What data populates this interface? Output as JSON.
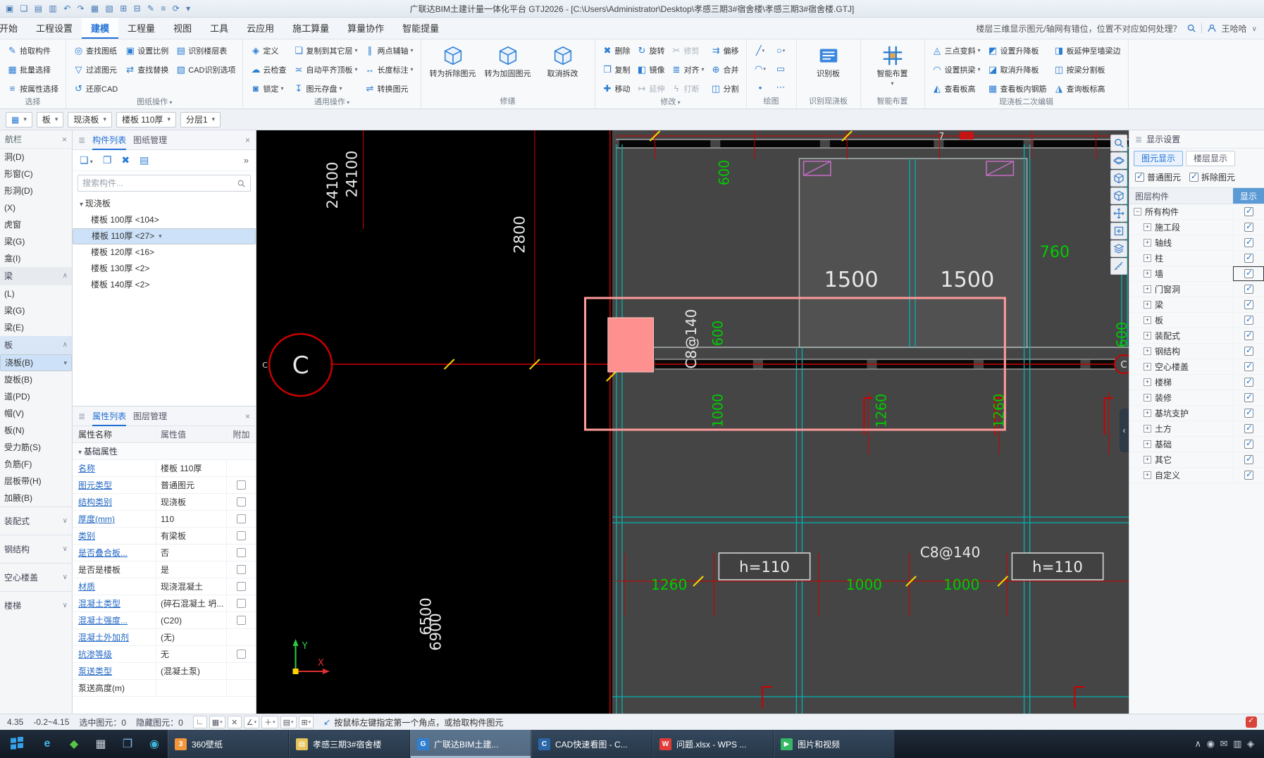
{
  "app": {
    "title": "广联达BIM土建计量一体化平台 GTJ2026 - [C:\\Users\\Administrator\\Desktop\\孝感三期3#宿舍楼\\孝感三期3#宿舍楼.GTJ]",
    "quick_icons": "▣ ❏ ▤ ▥ ↶ ↷ ▦ ▧ ⊞ ⊟ ✎ ≡ ⟳ ▾"
  },
  "tabs": {
    "items": [
      {
        "label": "开始"
      },
      {
        "label": "工程设置"
      },
      {
        "label": "建模",
        "active": true
      },
      {
        "label": "工程量"
      },
      {
        "label": "视图"
      },
      {
        "label": "工具"
      },
      {
        "label": "云应用"
      },
      {
        "label": "施工算量"
      },
      {
        "label": "算量协作"
      },
      {
        "label": "智能提量"
      }
    ],
    "help_text": "楼层三维显示图元/轴网有错位，位置不对应如何处理？",
    "user": "王哈哈"
  },
  "ribbon": {
    "select": {
      "label": "选择",
      "buttons": [
        {
          "t": "拾取构件",
          "i": "✎"
        },
        {
          "t": "批量选择",
          "i": "▦"
        },
        {
          "t": "按属性选择",
          "i": "≡"
        }
      ]
    },
    "sheet_ops": {
      "label": "图纸操作",
      "buttons": [
        {
          "t": "查找图纸",
          "i": "◎"
        },
        {
          "t": "设置比例",
          "i": "▣"
        },
        {
          "t": "识别楼层表",
          "i": "▤"
        },
        {
          "t": "过滤图元",
          "i": "▽"
        },
        {
          "t": "查找替换",
          "i": "⇄"
        },
        {
          "t": "CAD识别选项",
          "i": "▧"
        },
        {
          "t": "还原CAD",
          "i": "↺"
        }
      ]
    },
    "common_ops": {
      "label": "通用操作",
      "buttons": [
        {
          "t": "定义",
          "i": "◈"
        },
        {
          "t": "复制到其它层",
          "i": "❏",
          "dd": true
        },
        {
          "t": "两点辅轴",
          "i": "∥",
          "dd": true
        },
        {
          "t": "云检查",
          "i": "☁"
        },
        {
          "t": "自动平齐顶板",
          "i": "≍",
          "dd": true
        },
        {
          "t": "长度标注",
          "i": "↔",
          "dd": true
        },
        {
          "t": "锁定",
          "i": "◙",
          "dd": true
        },
        {
          "t": "图元存盘",
          "i": "↧",
          "dd": true
        },
        {
          "t": "转换图元",
          "i": "⇌"
        }
      ]
    },
    "renovation": {
      "label": "修缮",
      "buttons": [
        {
          "t": "转为拆除图元"
        },
        {
          "t": "转为加固图元"
        },
        {
          "t": "取消拆改"
        }
      ]
    },
    "modify": {
      "label": "修改",
      "buttons": [
        {
          "t": "删除",
          "i": "✖"
        },
        {
          "t": "旋转",
          "i": "↻"
        },
        {
          "t": "修剪",
          "i": "✂",
          "dis": true
        },
        {
          "t": "偏移",
          "i": "⇉"
        },
        {
          "t": "复制",
          "i": "❐"
        },
        {
          "t": "镜像",
          "i": "◧"
        },
        {
          "t": "对齐",
          "i": "≣",
          "dd": true
        },
        {
          "t": "合并",
          "i": "⊕"
        },
        {
          "t": "移动",
          "i": "✚"
        },
        {
          "t": "延伸",
          "i": "↦",
          "dis": true
        },
        {
          "t": "打断",
          "i": "ϟ",
          "dis": true
        },
        {
          "t": "分割",
          "i": "◫"
        }
      ]
    },
    "draw": {
      "label": "绘图",
      "tools": [
        {
          "i": "╱",
          "dd": true
        },
        {
          "i": "○",
          "dd": true
        },
        {
          "i": "◠",
          "dd": true
        },
        {
          "i": "▭"
        },
        {
          "i": "•"
        },
        {
          "i": "⋯"
        }
      ]
    },
    "identify": {
      "label": "识别现浇板",
      "button": "识别板"
    },
    "smart": {
      "label": "智能布置",
      "button": "智能布置"
    },
    "slab_edit": {
      "label": "现浇板二次编辑",
      "buttons": [
        {
          "t": "三点变斜",
          "i": "◬",
          "dd": true
        },
        {
          "t": "设置升降板",
          "i": "◩"
        },
        {
          "t": "板延伸至墙梁边",
          "i": "◨"
        },
        {
          "t": "设置拱梁",
          "i": "◠",
          "dd": true
        },
        {
          "t": "取消升降板",
          "i": "◪"
        },
        {
          "t": "按梁分割板",
          "i": "◫"
        },
        {
          "t": "查看板高",
          "i": "◭"
        },
        {
          "t": "查看板内钢筋",
          "i": "▦"
        },
        {
          "t": "查询板标高",
          "i": "◮"
        }
      ]
    }
  },
  "selector": {
    "type_icon": "▦",
    "dropdowns": [
      {
        "label": "板"
      },
      {
        "label": "现浇板"
      },
      {
        "label": "楼板 110厚"
      },
      {
        "label": "分层1"
      }
    ]
  },
  "nav": {
    "title": "航栏",
    "close": "×",
    "items": [
      {
        "label": "洞(D)"
      },
      {
        "label": "形窗(C)"
      },
      {
        "label": "形洞(D)"
      },
      {
        "label": "(X)"
      },
      {
        "label": "虎窗"
      },
      {
        "label": "梁(G)"
      },
      {
        "label": "龛(I)"
      },
      {
        "label": "梁",
        "sec": true
      },
      {
        "label": "(L)"
      },
      {
        "label": "梁(G)"
      },
      {
        "label": "梁(E)"
      },
      {
        "label": "板",
        "sec": true,
        "hl": true
      },
      {
        "label": "浇板(B)",
        "sel": true
      },
      {
        "label": "旋板(B)"
      },
      {
        "label": "道(PD)"
      },
      {
        "label": "帽(V)"
      },
      {
        "label": "板(N)"
      },
      {
        "label": "受力筋(S)"
      },
      {
        "label": "负筋(F)"
      },
      {
        "label": "层板带(H)"
      },
      {
        "label": "加腋(B)"
      },
      {
        "label": "装配式",
        "grp": true
      },
      {
        "label": "钢结构",
        "grp": true
      },
      {
        "label": "空心楼盖",
        "grp": true
      },
      {
        "label": "楼梯",
        "grp": true
      }
    ]
  },
  "components": {
    "tabs": [
      {
        "label": "构件列表",
        "active": true
      },
      {
        "label": "图纸管理"
      }
    ],
    "toolbar": {
      "new": "❏",
      "copy": "❐",
      "del": "✖",
      "store": "▤",
      "more": "»"
    },
    "search_placeholder": "搜索构件...",
    "root": "现浇板",
    "items": [
      {
        "label": "楼板 100厚 <104>"
      },
      {
        "label": "楼板 110厚 <27>",
        "sel": true
      },
      {
        "label": "楼板 120厚 <16>"
      },
      {
        "label": "楼板 130厚 <2>"
      },
      {
        "label": "楼板 140厚 <2>"
      }
    ]
  },
  "properties": {
    "tabs": [
      {
        "label": "属性列表",
        "active": true
      },
      {
        "label": "图层管理"
      }
    ],
    "columns": [
      "属性名称",
      "属性值",
      "附加"
    ],
    "group": "基础属性",
    "rows": [
      {
        "name": "名称",
        "value": "楼板 110厚",
        "link": true
      },
      {
        "name": "图元类型",
        "value": "普通图元",
        "link": true,
        "cb": true
      },
      {
        "name": "结构类别",
        "value": "现浇板",
        "link": true,
        "cb": true
      },
      {
        "name": "厚度(mm)",
        "value": "110",
        "link": true,
        "cb": true
      },
      {
        "name": "类别",
        "value": "有梁板",
        "link": true,
        "cb": true
      },
      {
        "name": "是否叠合板...",
        "value": "否",
        "link": true,
        "cb": true
      },
      {
        "name": "是否是楼板",
        "value": "是",
        "cb": true
      },
      {
        "name": "材质",
        "value": "现浇混凝土",
        "link": true,
        "cb": true
      },
      {
        "name": "混凝土类型",
        "value": "(碎石混凝土 坍...",
        "link": true,
        "cb": true
      },
      {
        "name": "混凝土强度...",
        "value": "(C20)",
        "link": true,
        "cb": true
      },
      {
        "name": "混凝土外加剂",
        "value": "(无)",
        "link": true
      },
      {
        "name": "抗渗等级",
        "value": "无",
        "link": true,
        "cb": true
      },
      {
        "name": "泵送类型",
        "value": "(混凝土泵)",
        "link": true
      },
      {
        "name": "泵送高度(m)",
        "value": ""
      }
    ]
  },
  "display": {
    "title": "显示设置",
    "tabs": [
      {
        "label": "图元显示",
        "active": true
      },
      {
        "label": "楼层显示"
      }
    ],
    "filters": [
      {
        "label": "普通图元",
        "checked": true
      },
      {
        "label": "拆除图元",
        "checked": true
      }
    ],
    "columns": [
      "图层构件",
      "显示"
    ],
    "rows": [
      {
        "label": "所有构件",
        "e": "−",
        "cb": true
      },
      {
        "label": "施工段",
        "e": "+",
        "ind": true,
        "cb": true
      },
      {
        "label": "轴线",
        "e": "+",
        "ind": true,
        "cb": true
      },
      {
        "label": "柱",
        "e": "+",
        "ind": true,
        "cb": true
      },
      {
        "label": "墙",
        "e": "+",
        "ind": true,
        "cb": true,
        "focus": true
      },
      {
        "label": "门窗洞",
        "e": "+",
        "ind": true,
        "cb": true
      },
      {
        "label": "梁",
        "e": "+",
        "ind": true,
        "cb": true
      },
      {
        "label": "板",
        "e": "+",
        "ind": true,
        "cb": true
      },
      {
        "label": "装配式",
        "e": "+",
        "ind": true,
        "cb": true
      },
      {
        "label": "钢结构",
        "e": "+",
        "ind": true,
        "cb": true
      },
      {
        "label": "空心楼盖",
        "e": "+",
        "ind": true,
        "cb": true
      },
      {
        "label": "楼梯",
        "e": "+",
        "ind": true,
        "cb": true
      },
      {
        "label": "装修",
        "e": "+",
        "ind": true,
        "cb": true
      },
      {
        "label": "基坑支护",
        "e": "+",
        "ind": true,
        "cb": true
      },
      {
        "label": "土方",
        "e": "+",
        "ind": true,
        "cb": true
      },
      {
        "label": "基础",
        "e": "+",
        "ind": true,
        "cb": true
      },
      {
        "label": "其它",
        "e": "+",
        "ind": true,
        "cb": true
      },
      {
        "label": "自定义",
        "e": "+",
        "ind": true,
        "cb": true
      }
    ]
  },
  "canvas": {
    "bubble_left": "C",
    "bubble_right": "C",
    "edge_label": "C",
    "grid_no": "7",
    "d_24100a": "24100",
    "d_24100b": "24100",
    "d_2800": "2800",
    "d_6500": "6500",
    "d_6900": "6900",
    "d_1500a": "1500",
    "d_1500b": "1500",
    "rebar_v": "C8@140",
    "rebar_h": "C8@140",
    "h110a": "h=110",
    "h110b": "h=110",
    "g600a": "600",
    "g600b": "600",
    "g600c": "600",
    "g760": "760",
    "g1000a": "1000",
    "g1000b": "1000",
    "g1000c": "1000",
    "g1260a": "1260",
    "g1260b": "1260",
    "g1260c": "1260",
    "axis_x": "X",
    "axis_y": "Y"
  },
  "statusbar": {
    "left1": "4.35",
    "left2": "-0.2~4.15",
    "selected": "选中图元：0",
    "hidden": "隐藏图元：0",
    "tools": [
      {
        "g": "∟"
      },
      {
        "g": "▦",
        "dd": true
      },
      {
        "g": "✕"
      },
      {
        "g": "∠",
        "dd": true
      },
      {
        "g": "＋",
        "dd": true
      },
      {
        "g": "▤",
        "dd": true
      },
      {
        "g": "⊞",
        "dd": true
      }
    ],
    "hint_icon": "↙",
    "hint": "按鼠标左键指定第一个角点，或拾取构件图元"
  },
  "taskbar": {
    "quick": [
      {
        "g": "e",
        "c": "#45b5e8"
      },
      {
        "g": "◆",
        "c": "#57c443"
      },
      {
        "g": "▦",
        "c": "#c9d2da"
      },
      {
        "g": "❐",
        "c": "#7fb3e8"
      },
      {
        "g": "◉",
        "c": "#3fb6d9"
      }
    ],
    "tasks": [
      {
        "label": "360壁纸",
        "ic": "3",
        "c": "#f2953b"
      },
      {
        "label": "孝感三期3#宿舍楼",
        "ic": "▤",
        "c": "#e8c35a"
      },
      {
        "label": "广联达BIM土建...",
        "ic": "G",
        "c": "#2e7fd0",
        "active": true
      },
      {
        "label": "CAD快速看图 - C...",
        "ic": "C",
        "c": "#2b66a8"
      },
      {
        "label": "问题.xlsx - WPS ...",
        "ic": "W",
        "c": "#e23c39"
      },
      {
        "label": "图片和视频",
        "ic": "▶",
        "c": "#35b764"
      }
    ],
    "tray": "∧ ◉ ✉ ▥ ◈"
  }
}
